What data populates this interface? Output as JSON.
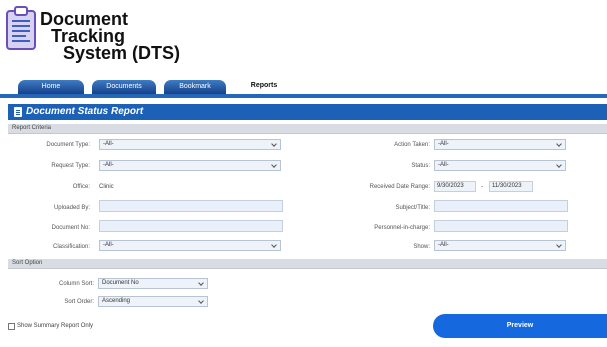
{
  "app": {
    "title_line1": "Document",
    "title_line2": "Tracking",
    "title_line3": "System (DTS)",
    "logo_icon": "clipboard-document-icon"
  },
  "tabs": [
    {
      "label": "Home",
      "active": false
    },
    {
      "label": "Documents",
      "active": false
    },
    {
      "label": "Bookmark",
      "active": false
    },
    {
      "label": "Reports",
      "active": true
    }
  ],
  "report": {
    "title": "Document Status Report",
    "icon": "document-icon",
    "criteria_header": "Report Criteria",
    "fields": {
      "document_type": {
        "label": "Document Type:",
        "value": "-All-"
      },
      "request_type": {
        "label": "Request Type:",
        "value": "-All-"
      },
      "office": {
        "label": "Office:",
        "value": "Clinic"
      },
      "uploaded_by": {
        "label": "Uploaded By:",
        "value": ""
      },
      "document_no": {
        "label": "Document No:",
        "value": ""
      },
      "classification": {
        "label": "Classification:",
        "value": "-All-"
      },
      "action_taken": {
        "label": "Action Taken:",
        "value": "-All-"
      },
      "status": {
        "label": "Status:",
        "value": "-All-"
      },
      "received_date_range": {
        "label": "Received Date Range:",
        "from": "9/30/2023",
        "separator": "-",
        "to": "11/30/2023"
      },
      "subject_title": {
        "label": "Subject/Title:",
        "value": ""
      },
      "personnel_in_charge": {
        "label": "Personnel-in-charge:",
        "value": ""
      },
      "show": {
        "label": "Show:",
        "value": "-All-"
      }
    }
  },
  "sort": {
    "header": "Sort Option",
    "column_sort": {
      "label": "Column Sort:",
      "value": "Document No"
    },
    "sort_order": {
      "label": "Sort Order:",
      "value": "Ascending"
    }
  },
  "footer": {
    "summary_label": "Show Summary Report Only",
    "summary_checked": false,
    "preview_label": "Preview"
  },
  "colors": {
    "brand_blue": "#1c61b5",
    "preview_blue": "#1668de",
    "tab_gradient_top": "#3d7cc4",
    "tab_gradient_bottom": "#16418a"
  }
}
